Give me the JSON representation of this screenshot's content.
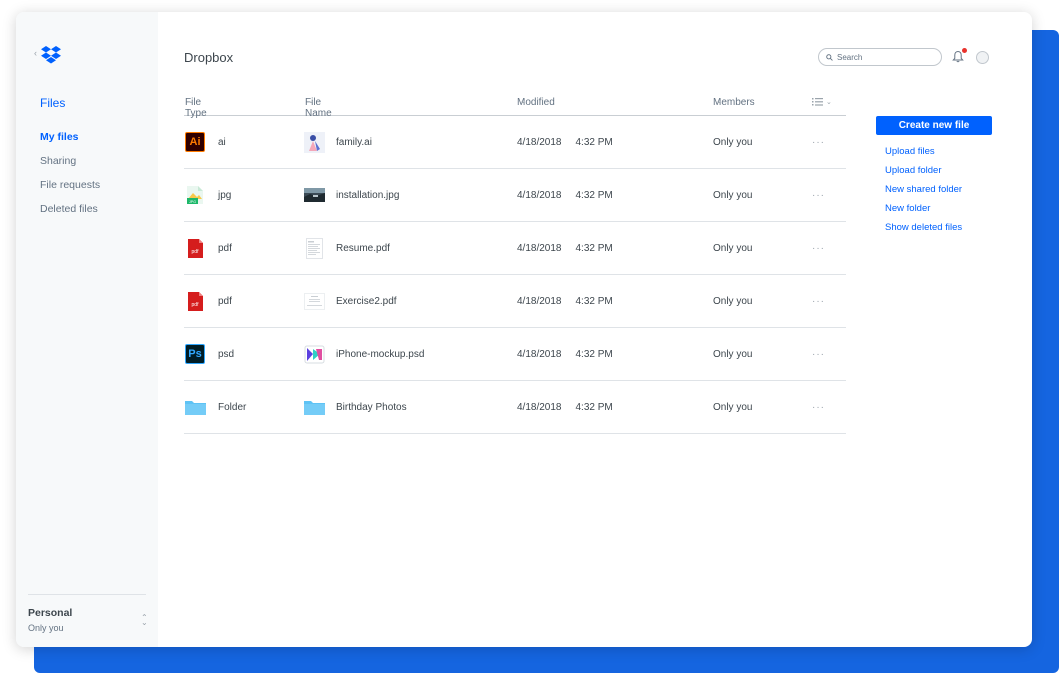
{
  "sidebar": {
    "back_glyph": "‹",
    "title": "Files",
    "nav": [
      "My files",
      "Sharing",
      "File requests",
      "Deleted files"
    ],
    "account": {
      "name": "Personal",
      "subtitle": "Only you"
    }
  },
  "header": {
    "title": "Dropbox",
    "search_placeholder": "Search"
  },
  "table": {
    "columns": {
      "type": "File Type",
      "name": "File Name",
      "modified": "Modified",
      "members": "Members"
    },
    "rows": [
      {
        "icon": "illustrator-icon",
        "type": "ai",
        "thumb": "illustration-thumbnail",
        "name": "family.ai",
        "date": "4/18/2018",
        "time": "4:32 PM",
        "members": "Only you",
        "more": "···"
      },
      {
        "icon": "image-file-icon",
        "type": "jpg",
        "thumb": "photo-thumbnail",
        "name": "installation.jpg",
        "date": "4/18/2018",
        "time": "4:32 PM",
        "members": "Only you",
        "more": "···"
      },
      {
        "icon": "pdf-icon",
        "type": "pdf",
        "thumb": "document-thumbnail",
        "name": "Resume.pdf",
        "date": "4/18/2018",
        "time": "4:32 PM",
        "members": "Only you",
        "more": "···"
      },
      {
        "icon": "pdf-icon",
        "type": "pdf",
        "thumb": "document-thumbnail",
        "name": "Exercise2.pdf",
        "date": "4/18/2018",
        "time": "4:32 PM",
        "members": "Only you",
        "more": "···"
      },
      {
        "icon": "photoshop-icon",
        "type": "psd",
        "thumb": "psd-thumbnail",
        "name": "iPhone-mockup.psd",
        "date": "4/18/2018",
        "time": "4:32 PM",
        "members": "Only you",
        "more": "···"
      },
      {
        "icon": "folder-icon",
        "type": "Folder",
        "thumb": "folder-icon",
        "name": "Birthday Photos",
        "date": "4/18/2018",
        "time": "4:32 PM",
        "members": "Only you",
        "more": "···"
      }
    ]
  },
  "badges": {
    "ai": "Ai",
    "ps": "Ps",
    "pdf": "pdf",
    "jpg": "JPG"
  },
  "actions": {
    "primary": "Create new file",
    "links": [
      "Upload files",
      "Upload folder",
      "New shared folder",
      "New folder",
      "Show deleted files"
    ]
  },
  "colors": {
    "accent": "#0061fe",
    "backdrop": "#1565e0",
    "pdf": "#d51d1d",
    "folder": "#5ec3f5",
    "notification": "#e8322c"
  }
}
